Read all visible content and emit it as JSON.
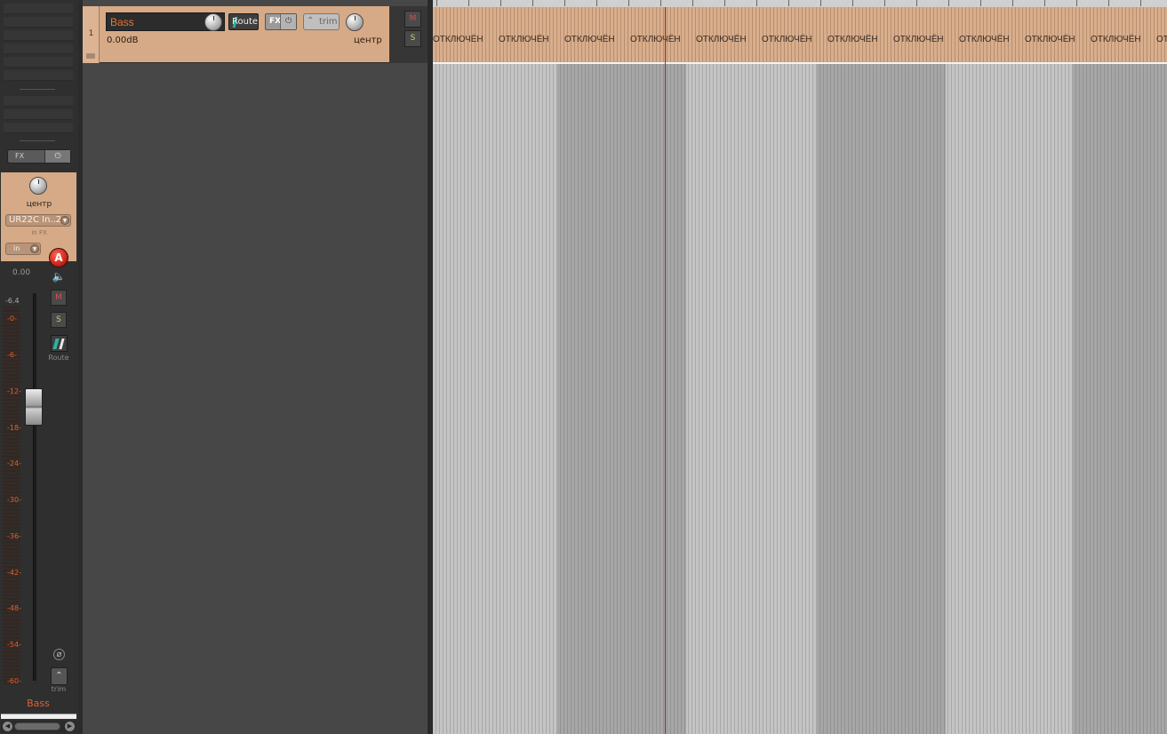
{
  "mixer": {
    "fx_label": "FX",
    "fx_power_glyph": "⏻",
    "pan_label": "центр",
    "input_name": "UR22C In..2",
    "input_fx_label": "In FX",
    "monitor_label": "in",
    "arm_label": "A",
    "volume_value": "0.00",
    "peak_value": "-6.4",
    "db_scale": [
      "-0-",
      "-6-",
      "-12-",
      "-18-",
      "-24-",
      "-30-",
      "-36-",
      "-42-",
      "-48-",
      "-54-",
      "-60-"
    ],
    "mute_label": "M",
    "solo_label": "S",
    "route_label": "Route",
    "phase_glyph": "⌀",
    "trim_label": "trim",
    "track_name": "Bass",
    "scroll_left": "◀",
    "scroll_right": "▶"
  },
  "tcp": {
    "track_number": "1",
    "track_name": "Bass",
    "route_label": "Route",
    "fx_label": "FX",
    "fx_power_glyph": "⏻",
    "trim_label": "trim",
    "volume_value": "0.00dB",
    "pan_label": "центр",
    "mute_label": "M",
    "solo_label": "S"
  },
  "arrange": {
    "segment_label": "ОТКЛЮЧЁН",
    "segment_count": 12
  },
  "colors": {
    "track_tan": "#d6aa86",
    "track_name_orange": "#e8742e",
    "mute_red": "#d45050",
    "solo_yellow": "#c9c96a",
    "cursor_red": "#b02020",
    "route_teal": "#2bb3a3"
  }
}
